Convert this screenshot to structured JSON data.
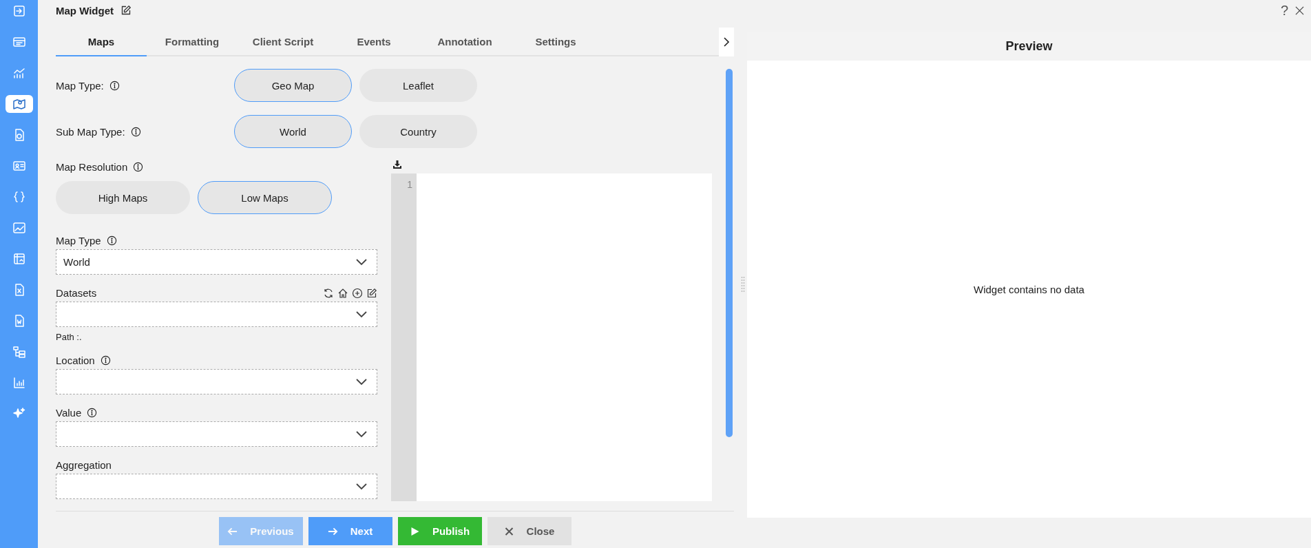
{
  "sidebar": {
    "items": [
      {
        "kind": "exit",
        "selected": false
      },
      {
        "kind": "table",
        "selected": false
      },
      {
        "kind": "chart",
        "selected": false
      },
      {
        "kind": "map",
        "selected": true
      },
      {
        "kind": "report",
        "selected": false
      },
      {
        "kind": "card",
        "selected": false
      },
      {
        "kind": "code",
        "selected": false
      },
      {
        "kind": "image",
        "selected": false
      },
      {
        "kind": "pivot",
        "selected": false
      },
      {
        "kind": "excel",
        "selected": false
      },
      {
        "kind": "word",
        "selected": false
      },
      {
        "kind": "tree",
        "selected": false
      },
      {
        "kind": "bars",
        "selected": false
      },
      {
        "kind": "sparkle",
        "selected": false
      }
    ]
  },
  "window": {
    "title": "Map Widget",
    "help": "?"
  },
  "tabs": [
    {
      "label": "Maps",
      "selected": true
    },
    {
      "label": "Formatting",
      "selected": false
    },
    {
      "label": "Client Script",
      "selected": false
    },
    {
      "label": "Events",
      "selected": false
    },
    {
      "label": "Annotation",
      "selected": false
    },
    {
      "label": "Settings",
      "selected": false
    }
  ],
  "form": [
    {
      "kind": "options",
      "label": "Map Type:",
      "inline": true,
      "options": [
        {
          "label": "Geo Map",
          "selected": true
        },
        {
          "label": "Leaflet",
          "selected": false
        }
      ]
    },
    {
      "kind": "options",
      "label": "Sub Map Type:",
      "inline": true,
      "options": [
        {
          "label": "World",
          "selected": true
        },
        {
          "label": "Country",
          "selected": false
        }
      ]
    },
    {
      "kind": "options",
      "label": "Map Resolution",
      "inline": false,
      "options": [
        {
          "label": "High Maps",
          "selected": false
        },
        {
          "label": "Low Maps",
          "selected": true
        }
      ]
    },
    {
      "kind": "select",
      "label": "Map Type",
      "info": true,
      "tools": false,
      "value": "World"
    },
    {
      "kind": "select",
      "label": "Datasets",
      "info": false,
      "tools": true,
      "path": "Path :."
    },
    {
      "kind": "select",
      "label": "Location",
      "info": true,
      "tools": false
    },
    {
      "kind": "select",
      "label": "Value",
      "info": true,
      "tools": false
    },
    {
      "kind": "select",
      "label": "Aggregation",
      "info": false,
      "tools": false
    }
  ],
  "editor": {
    "line_numbers": [
      "1"
    ]
  },
  "buttons": [
    {
      "kind": "previous",
      "label": "Previous",
      "disabled": true
    },
    {
      "kind": "next",
      "label": "Next",
      "disabled": false
    },
    {
      "kind": "publish",
      "label": "Publish",
      "disabled": false
    },
    {
      "kind": "close",
      "label": "Close",
      "disabled": false
    }
  ],
  "preview": {
    "title": "Preview",
    "message": "Widget contains no data"
  }
}
